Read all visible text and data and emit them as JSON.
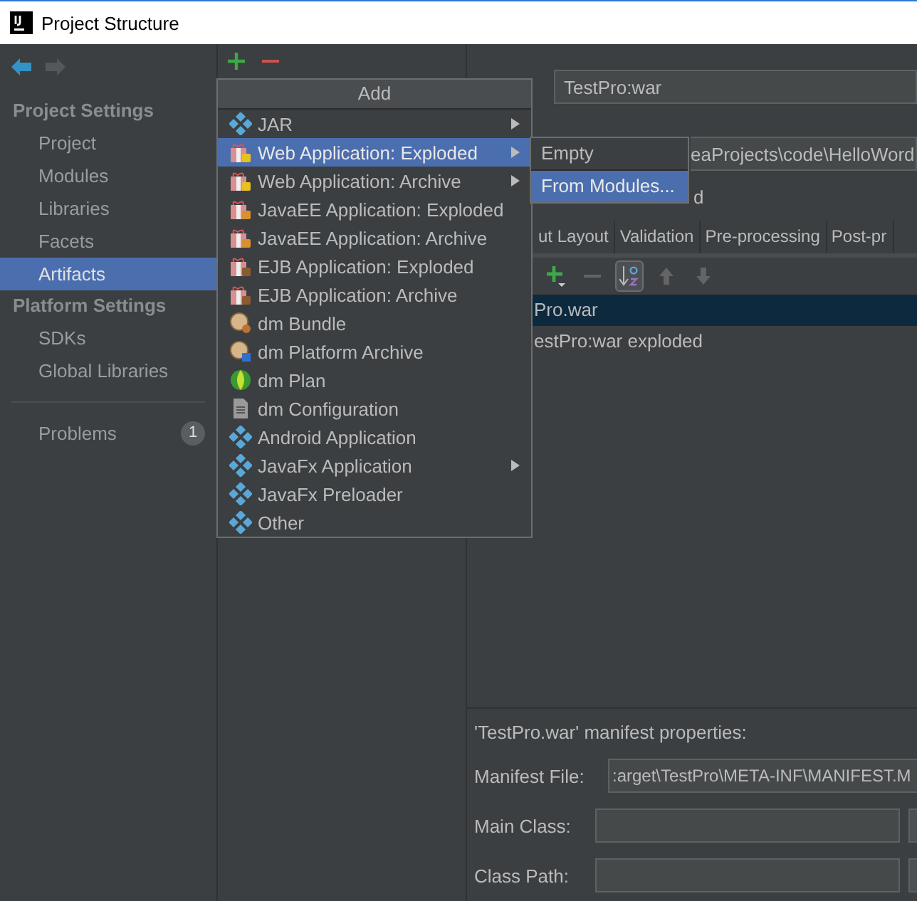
{
  "window": {
    "title": "Project Structure"
  },
  "sidebar": {
    "sections": [
      {
        "title": "Project Settings",
        "items": [
          {
            "label": "Project",
            "selected": false
          },
          {
            "label": "Modules",
            "selected": false
          },
          {
            "label": "Libraries",
            "selected": false
          },
          {
            "label": "Facets",
            "selected": false
          },
          {
            "label": "Artifacts",
            "selected": true
          }
        ]
      },
      {
        "title": "Platform Settings",
        "items": [
          {
            "label": "SDKs",
            "selected": false
          },
          {
            "label": "Global Libraries",
            "selected": false
          }
        ]
      }
    ],
    "problems": {
      "label": "Problems",
      "count": "1"
    }
  },
  "add_menu": {
    "title": "Add",
    "items": [
      {
        "label": "JAR",
        "kind": "module",
        "submenu": true,
        "selected": false
      },
      {
        "label": "Web Application: Exploded",
        "kind": "web",
        "submenu": true,
        "selected": true
      },
      {
        "label": "Web Application: Archive",
        "kind": "web",
        "submenu": true,
        "selected": false
      },
      {
        "label": "JavaEE Application: Exploded",
        "kind": "javaee",
        "submenu": false,
        "selected": false
      },
      {
        "label": "JavaEE Application: Archive",
        "kind": "javaee",
        "submenu": false,
        "selected": false
      },
      {
        "label": "EJB Application: Exploded",
        "kind": "ejb",
        "submenu": false,
        "selected": false
      },
      {
        "label": "EJB Application: Archive",
        "kind": "ejb",
        "submenu": false,
        "selected": false
      },
      {
        "label": "dm Bundle",
        "kind": "bundle",
        "submenu": false,
        "selected": false
      },
      {
        "label": "dm Platform Archive",
        "kind": "bundle-archive",
        "submenu": false,
        "selected": false
      },
      {
        "label": "dm Plan",
        "kind": "plan",
        "submenu": false,
        "selected": false
      },
      {
        "label": "dm Configuration",
        "kind": "config",
        "submenu": false,
        "selected": false
      },
      {
        "label": "Android Application",
        "kind": "module",
        "submenu": false,
        "selected": false
      },
      {
        "label": "JavaFx Application",
        "kind": "module",
        "submenu": true,
        "selected": false
      },
      {
        "label": "JavaFx Preloader",
        "kind": "module",
        "submenu": false,
        "selected": false
      },
      {
        "label": "Other",
        "kind": "module",
        "submenu": false,
        "selected": false
      }
    ]
  },
  "submenu": {
    "items": [
      {
        "label": "Empty",
        "selected": false
      },
      {
        "label": "From Modules...",
        "selected": true
      }
    ]
  },
  "artifact": {
    "name": "TestPro:war",
    "output_directory": "eaProjects\\code\\HelloWord",
    "partial_label": "d",
    "tabs": [
      {
        "label": "ut Layout"
      },
      {
        "label": "Validation"
      },
      {
        "label": "Pre-processing"
      },
      {
        "label": "Post-pr"
      }
    ],
    "toolbar": [
      {
        "kind": "add",
        "disabled": false
      },
      {
        "kind": "remove",
        "disabled": true
      },
      {
        "kind": "sort",
        "disabled": false
      },
      {
        "kind": "up",
        "disabled": true
      },
      {
        "kind": "down",
        "disabled": true
      }
    ],
    "tree": [
      {
        "label": "Pro.war",
        "selected": true
      },
      {
        "label": "estPro:war exploded",
        "selected": false
      }
    ],
    "manifest": {
      "heading": "'TestPro.war' manifest properties:",
      "fields": [
        {
          "label": "Manifest File:",
          "value": ":arget\\TestPro\\META-INF\\MANIFEST.M"
        },
        {
          "label": "Main Class:"
        },
        {
          "label": "Class Path:"
        }
      ]
    }
  }
}
